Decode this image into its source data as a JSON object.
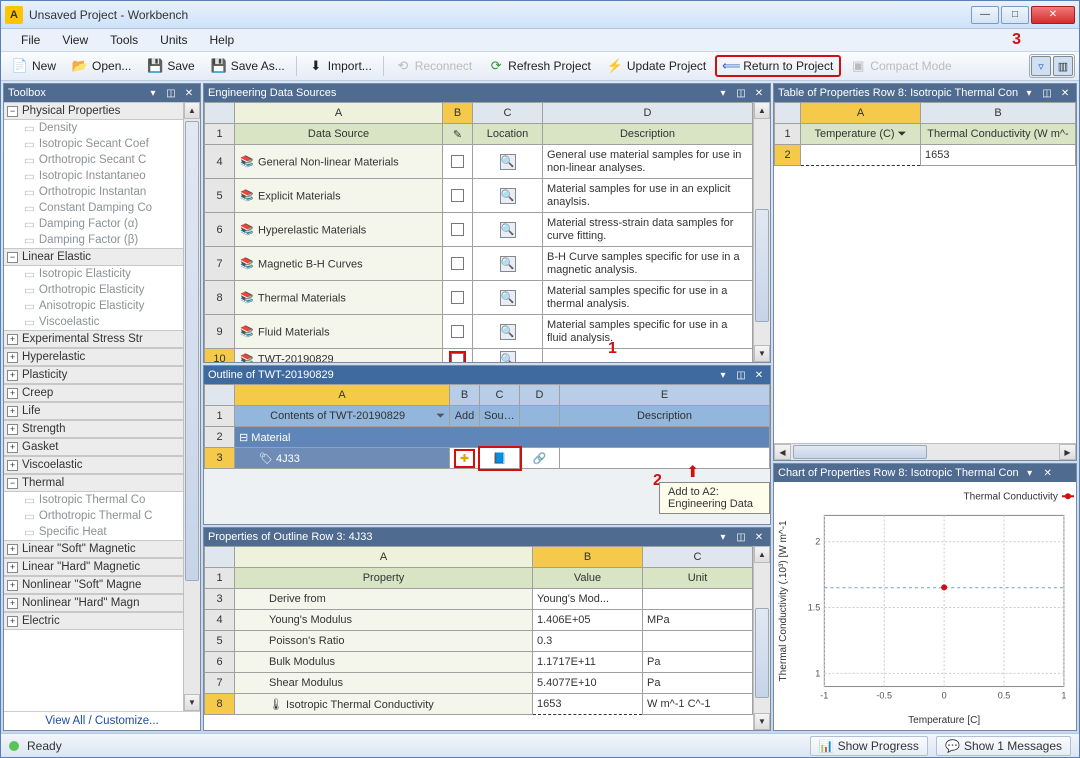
{
  "window": {
    "title": "Unsaved Project - Workbench",
    "app_glyph": "A"
  },
  "menu": {
    "items": [
      "File",
      "View",
      "Tools",
      "Units",
      "Help"
    ]
  },
  "toolbar": {
    "new": "New",
    "open": "Open...",
    "save": "Save",
    "saveas": "Save As...",
    "import": "Import...",
    "reconnect": "Reconnect",
    "refresh": "Refresh Project",
    "update": "Update Project",
    "return": "Return to Project",
    "compact": "Compact Mode"
  },
  "annotations": {
    "a1": "1",
    "a2": "2",
    "a3": "3"
  },
  "toolbox": {
    "title": "Toolbox",
    "groups": [
      {
        "name": "Physical Properties",
        "open": true,
        "items": [
          "Density",
          "Isotropic Secant Coef",
          "Orthotropic Secant C",
          "Isotropic Instantaneo",
          "Orthotropic Instantan",
          "Constant Damping Co",
          "Damping Factor (α)",
          "Damping Factor (β)"
        ]
      },
      {
        "name": "Linear Elastic",
        "open": true,
        "items": [
          "Isotropic Elasticity",
          "Orthotropic Elasticity",
          "Anisotropic Elasticity",
          "Viscoelastic"
        ]
      },
      {
        "name": "Experimental Stress Str",
        "open": false,
        "items": []
      },
      {
        "name": "Hyperelastic",
        "open": false,
        "items": []
      },
      {
        "name": "Plasticity",
        "open": false,
        "items": []
      },
      {
        "name": "Creep",
        "open": false,
        "items": []
      },
      {
        "name": "Life",
        "open": false,
        "items": []
      },
      {
        "name": "Strength",
        "open": false,
        "items": []
      },
      {
        "name": "Gasket",
        "open": false,
        "items": []
      },
      {
        "name": "Viscoelastic",
        "open": false,
        "items": []
      },
      {
        "name": "Thermal",
        "open": true,
        "items": [
          "Isotropic Thermal Co",
          "Orthotropic Thermal C",
          "Specific Heat"
        ]
      },
      {
        "name": "Linear \"Soft\" Magnetic",
        "open": false,
        "items": []
      },
      {
        "name": "Linear \"Hard\" Magnetic",
        "open": false,
        "items": []
      },
      {
        "name": "Nonlinear \"Soft\" Magne",
        "open": false,
        "items": []
      },
      {
        "name": "Nonlinear \"Hard\" Magn",
        "open": false,
        "items": []
      },
      {
        "name": "Electric",
        "open": false,
        "items": []
      }
    ],
    "footer": "View All / Customize..."
  },
  "eds": {
    "title": "Engineering Data Sources",
    "cols": {
      "A": "A",
      "B": "B",
      "C": "C",
      "D": "D"
    },
    "headers": {
      "ds": "Data Source",
      "loc": "Location",
      "desc": "Description"
    },
    "rows": [
      {
        "i": "4",
        "name": "General Non-linear Materials",
        "desc": "General use material samples for use in non-linear analyses.",
        "tall": true
      },
      {
        "i": "5",
        "name": "Explicit Materials",
        "desc": "Material samples for use in an explicit anaylsis.",
        "tall": true
      },
      {
        "i": "6",
        "name": "Hyperelastic Materials",
        "desc": "Material stress-strain data samples for curve fitting.",
        "tall": true
      },
      {
        "i": "7",
        "name": "Magnetic B-H Curves",
        "desc": "B-H Curve samples specific for use in a magnetic analysis.",
        "tall": true
      },
      {
        "i": "8",
        "name": "Thermal Materials",
        "desc": "Material samples specific for use in a thermal analysis.",
        "tall": true
      },
      {
        "i": "9",
        "name": "Fluid Materials",
        "desc": "Material samples specific for use in a fluid analysis.",
        "tall": true
      },
      {
        "i": "10",
        "name": "TWT-20190829",
        "desc": "",
        "sel": true
      }
    ]
  },
  "outline": {
    "title": "Outline of TWT-20190829",
    "cols": {
      "A": "A",
      "B": "B",
      "C": "C",
      "D": "D",
      "E": "E"
    },
    "headers": {
      "contents": "Contents of TWT-20190829",
      "add": "Add",
      "source": "Source",
      "desc": "Description"
    },
    "material_group": "Material",
    "rows": [
      {
        "i": "3",
        "name": "4J33"
      }
    ],
    "tooltip": "Add to A2: Engineering Data"
  },
  "props": {
    "title": "Properties of Outline Row 3: 4J33",
    "cols": {
      "A": "A",
      "B": "B",
      "C": "C"
    },
    "headers": {
      "property": "Property",
      "value": "Value",
      "unit": "Unit"
    },
    "rows": [
      {
        "i": "1",
        "name": "",
        "value": "",
        "unit": ""
      },
      {
        "i": "3",
        "name": "Derive from",
        "value": "Young's Mod...",
        "unit": ""
      },
      {
        "i": "4",
        "name": "Young's Modulus",
        "value": "1.406E+05",
        "unit": "MPa"
      },
      {
        "i": "5",
        "name": "Poisson's Ratio",
        "value": "0.3",
        "unit": ""
      },
      {
        "i": "6",
        "name": "Bulk Modulus",
        "value": "1.1717E+11",
        "unit": "Pa"
      },
      {
        "i": "7",
        "name": "Shear Modulus",
        "value": "5.4077E+10",
        "unit": "Pa"
      },
      {
        "i": "8",
        "name": "Isotropic Thermal Conductivity",
        "value": "1653",
        "unit": "W m^-1 C^-1",
        "sel": true,
        "icon": true
      }
    ]
  },
  "tableOfProps": {
    "title": "Table of Properties Row 8: Isotropic Thermal Con",
    "cols": {
      "A": "A",
      "B": "B"
    },
    "headers": {
      "temp": "Temperature (C)",
      "tc": "Thermal Conductivity (W m^-"
    },
    "rows": [
      {
        "i": "2",
        "temp": "",
        "tc": "1653"
      }
    ]
  },
  "chartPane": {
    "title": "Chart of Properties Row 8: Isotropic Thermal Con"
  },
  "chart_data": {
    "type": "scatter",
    "legend": "Thermal Conductivity",
    "xlabel": "Temperature [C]",
    "ylabel": "Thermal Conductivity (.10³) [W m^-1 ",
    "xticks": [
      -1,
      -0.5,
      0,
      0.5,
      1
    ],
    "yticks": [
      1,
      1.5,
      2
    ],
    "xlim": [
      -1,
      1
    ],
    "ylim": [
      0.9,
      2.2
    ],
    "ref_line_y": 1.65,
    "series": [
      {
        "name": "Thermal Conductivity",
        "color": "#d10f0f",
        "points": [
          [
            0,
            1.653
          ]
        ]
      }
    ]
  },
  "status": {
    "ready": "Ready",
    "show_progress": "Show Progress",
    "show_messages": "Show 1 Messages"
  }
}
